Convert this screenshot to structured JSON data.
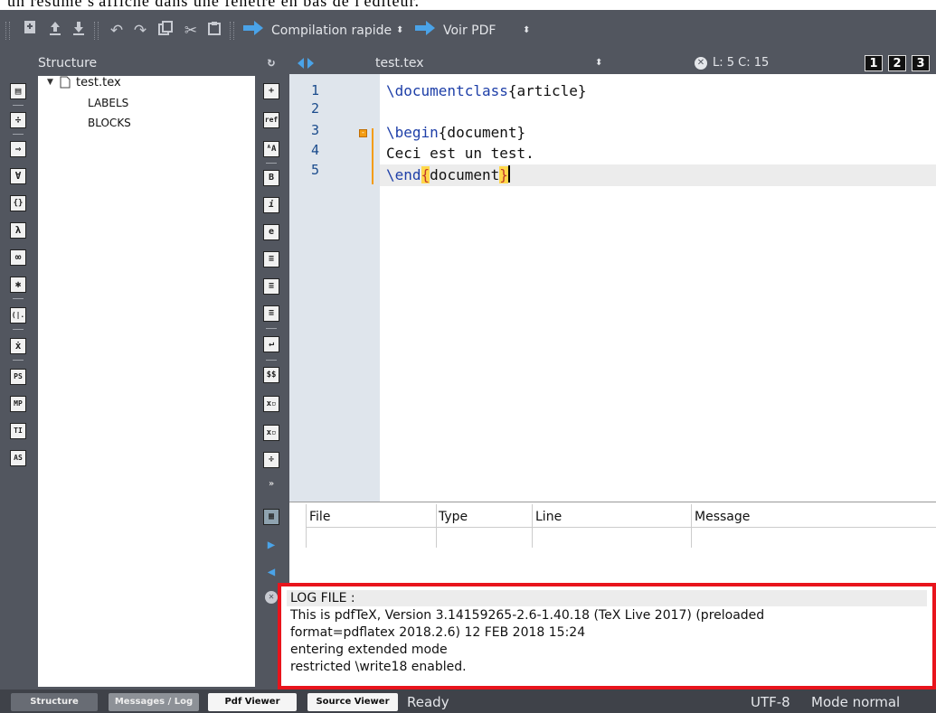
{
  "caption": "un résumé s'affiche dans une fenêtre en bas de l'éditeur.",
  "toolbar": {
    "compile_label": "Compilation rapide",
    "view_label": "Voir PDF"
  },
  "structure": {
    "title": "Structure",
    "tree": {
      "root": "test.tex",
      "children": [
        "LABELS",
        "BLOCKS"
      ]
    },
    "left_icons": [
      "▤",
      "÷",
      "⇒",
      "∀",
      "{}",
      "λ",
      "∞",
      "✱",
      "(|.",
      "ẋ",
      "PS",
      "MP",
      "TI",
      "AS"
    ]
  },
  "editor": {
    "filename": "test.tex",
    "position": "L: 5 C: 15",
    "view_buttons": [
      "1",
      "2",
      "3"
    ],
    "line_numbers": [
      "1",
      "2",
      "3",
      "4",
      "5"
    ]
  },
  "messages": {
    "columns": [
      "File",
      "Type",
      "Line",
      "Message"
    ],
    "log_heading": "LOG FILE :",
    "log_lines": [
      "This is pdfTeX, Version 3.14159265-2.6-1.40.18 (TeX Live 2017) (preloaded",
      "format=pdflatex 2018.2.6) 12 FEB 2018 15:24",
      "entering extended mode",
      "restricted \\write18 enabled."
    ]
  },
  "statusbar": {
    "tabs": [
      "Structure",
      "Messages / Log",
      "Pdf Viewer",
      "Source Viewer"
    ],
    "state": "Ready",
    "encoding": "UTF-8",
    "mode": "Mode normal"
  },
  "colors": {
    "panel": "#52565f",
    "gutter": "#dfe5ec",
    "highlight_frame": "#e8141c",
    "keyword": "#1e3fa8",
    "bracket_match": "#ffd84a"
  }
}
